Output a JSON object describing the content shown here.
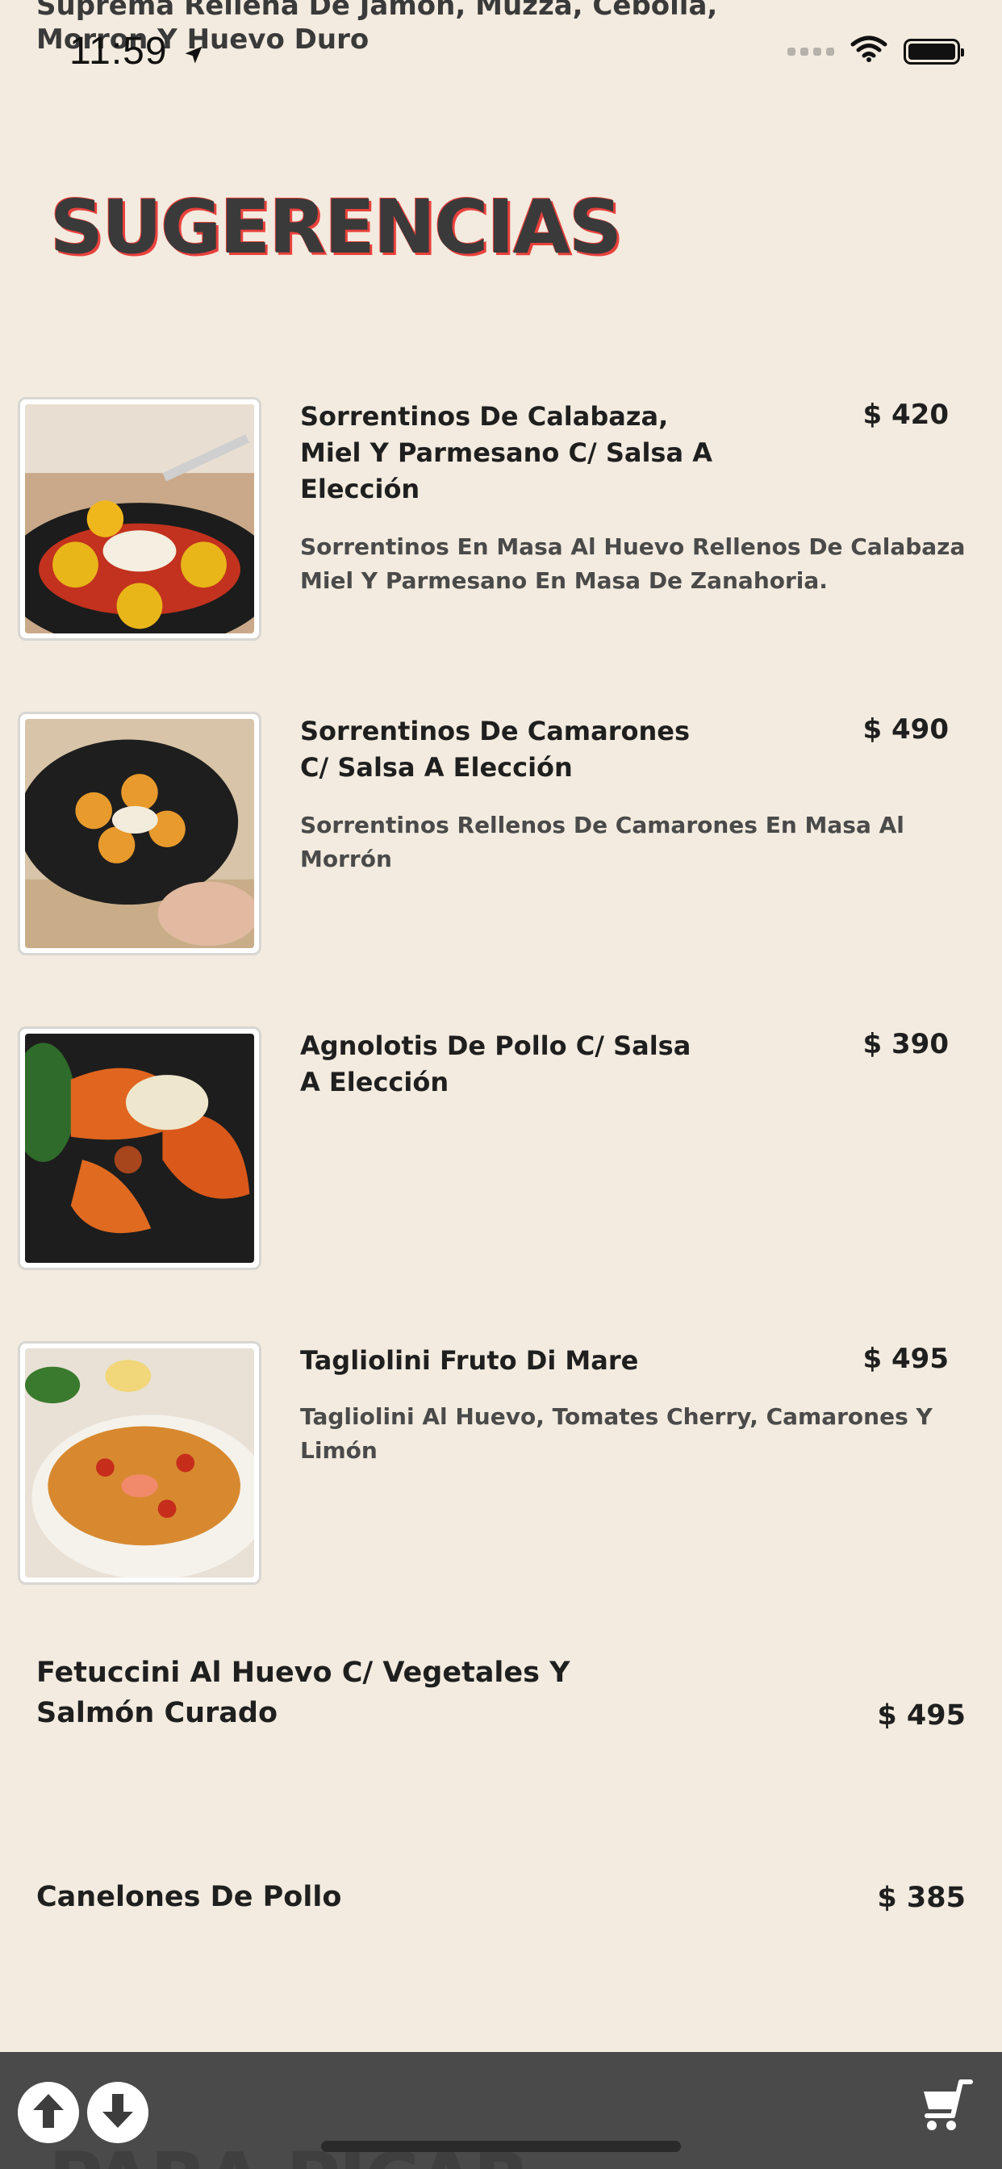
{
  "status_bar": {
    "time": "11:59",
    "icons": [
      "location-arrow-icon",
      "signal-icon",
      "wifi-icon",
      "battery-icon"
    ]
  },
  "previous_item": {
    "description": "Suprema Rellena De Jamon, Muzza, Cebolla, Morron Y Huevo Duro"
  },
  "section": {
    "title": "SUGERENCIAS"
  },
  "products": [
    {
      "name": "Sorrentinos De Calabaza, Miel Y Parmesano C/ Salsa A Elección",
      "price": "$ 420",
      "description": "Sorrentinos En Masa Al Huevo Rellenos De Calabaza Miel Y Parmesano En Masa De Zanahoria."
    },
    {
      "name": "Sorrentinos De Camarones C/ Salsa A Elección",
      "price": "$ 490",
      "description": "Sorrentinos Rellenos De Camarones En Masa Al Morrón"
    },
    {
      "name": "Agnolotis De Pollo C/ Salsa A Elección",
      "price": "$ 390",
      "description": ""
    },
    {
      "name": "Tagliolini Fruto Di Mare",
      "price": "$ 495",
      "description": "Tagliolini Al Huevo, Tomates Cherry, Camarones Y Limón"
    }
  ],
  "text_items": [
    {
      "name": "Fetuccini Al Huevo C/ Vegetales Y Salmón Curado",
      "price": "$ 495"
    },
    {
      "name": "Canelones De Pollo",
      "price": "$ 385"
    }
  ],
  "bottom_bar": {
    "peek_section_title": "PARA PICAR",
    "icons": [
      "arrow-up-icon",
      "arrow-down-icon",
      "cart-icon"
    ]
  },
  "colors": {
    "background": "#f3ebdf",
    "title_outline": "#e8413c",
    "bottom_bar": "#4a4a4a"
  }
}
